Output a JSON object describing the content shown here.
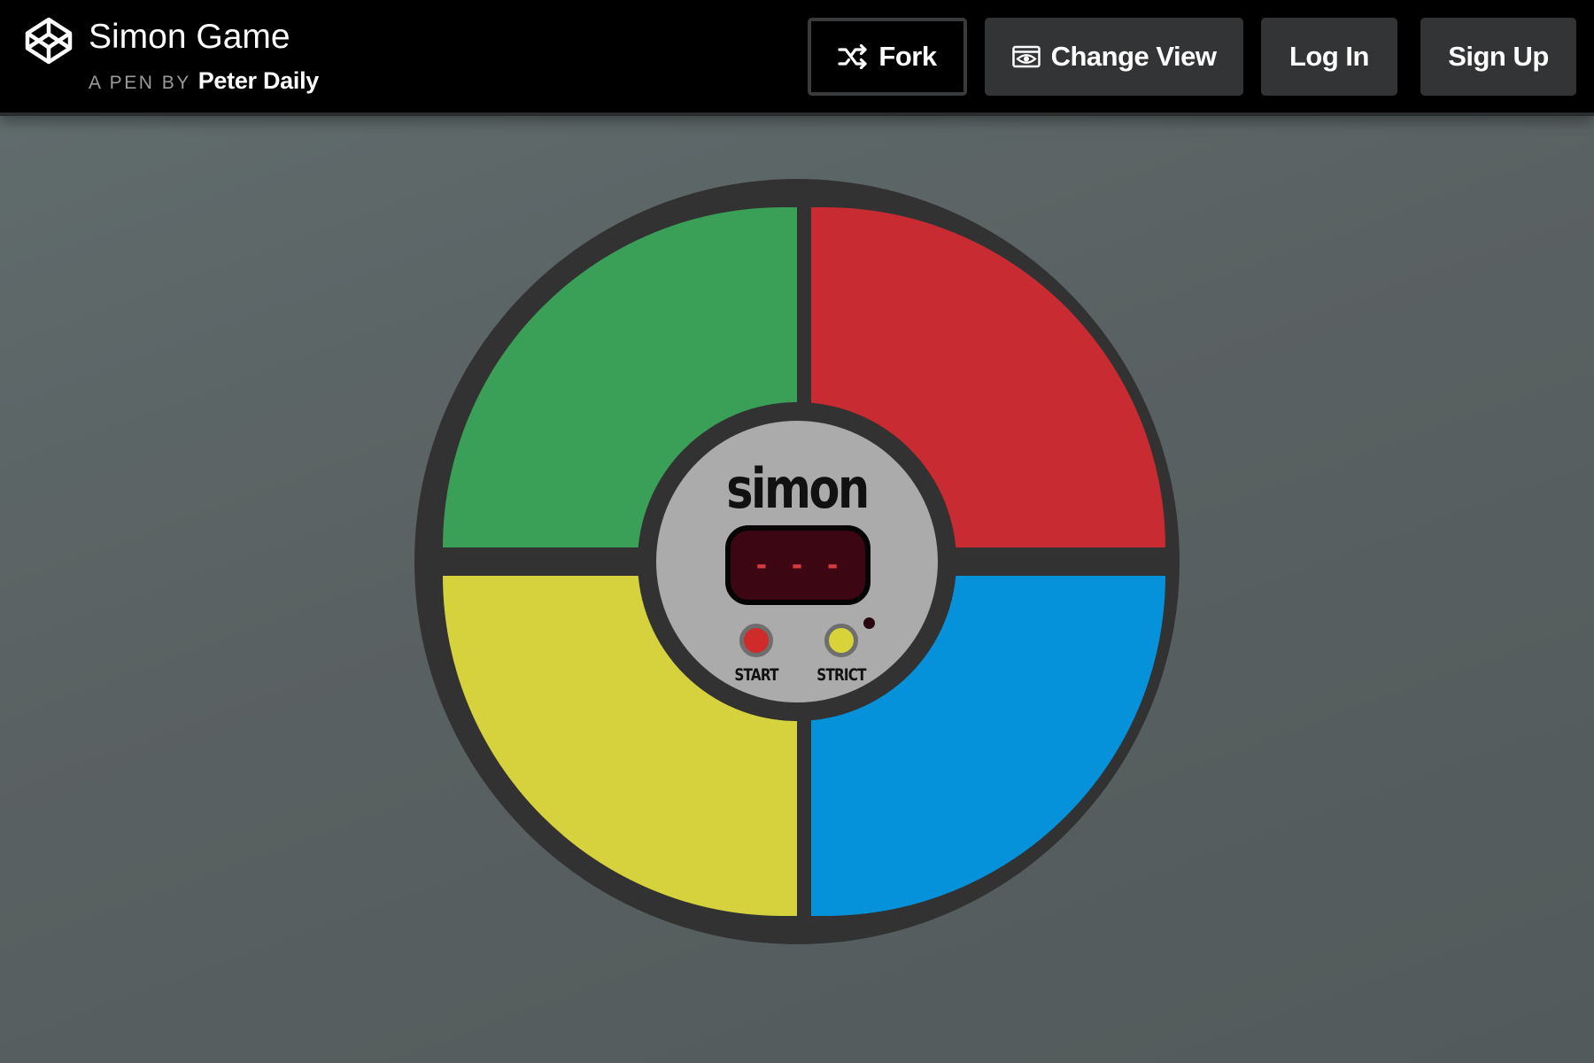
{
  "header": {
    "title": "Simon Game",
    "byline_prefix": "A PEN BY",
    "author": "Peter Daily",
    "logo_icon": "codepen-cube-icon",
    "buttons": {
      "fork": {
        "label": "Fork",
        "icon": "fork-icon"
      },
      "change_view": {
        "label": "Change View",
        "icon": "eye-window-icon"
      },
      "login": {
        "label": "Log In"
      },
      "signup": {
        "label": "Sign Up"
      }
    }
  },
  "game": {
    "brand": "simon",
    "display": "- - -",
    "controls": {
      "start_label": "START",
      "strict_label": "STRICT"
    },
    "colors": {
      "green": "#3a9f57",
      "red": "#c82b31",
      "yellow": "#d5d23d",
      "blue": "#0592db",
      "housing": "#323232",
      "center_panel": "#ababab",
      "display_bg": "#3c0612",
      "display_text": "#d73b3b"
    }
  }
}
